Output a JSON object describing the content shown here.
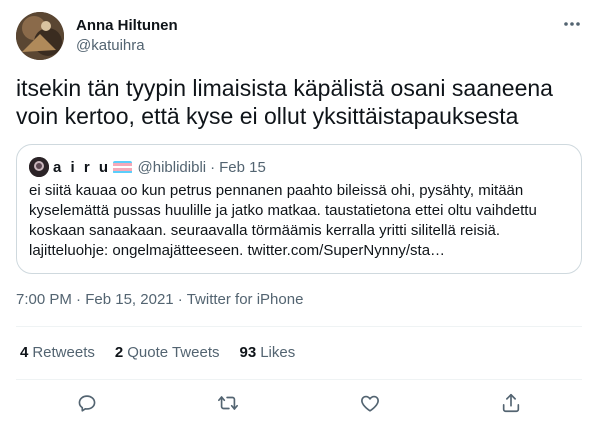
{
  "author": {
    "display_name": "Anna Hiltunen",
    "handle": "@katuihra"
  },
  "tweet": {
    "text": "itsekin tän tyypin limaisista käpälistä osani saaneena voin kertoo, että kyse ei ollut yksittäistapauksesta"
  },
  "quoted_tweet": {
    "display_name": "a i r u",
    "handle": "@hiblidibli",
    "separator": "·",
    "date": "Feb 15",
    "text": "ei siitä kauaa oo kun petrus pennanen paahto bileissä ohi, pysähty, mitään kyselemättä pussas huulille ja jatko matkaa. taustatietona ettei oltu vaihdettu koskaan sanaakaan. seuraavalla törmäämis kerralla yritti silitellä reisiä. lajitteluohje: ongelmajätteeseen. twitter.com/SuperNynny/sta…"
  },
  "meta": {
    "time": "7:00 PM",
    "sep1": "·",
    "date": "Feb 15, 2021",
    "sep2": "·",
    "source": "Twitter for iPhone"
  },
  "stats": {
    "retweets_count": "4",
    "retweets_label": "Retweets",
    "quotes_count": "2",
    "quotes_label": "Quote Tweets",
    "likes_count": "93",
    "likes_label": "Likes"
  },
  "colors": {
    "text_primary": "#0f1419",
    "text_secondary": "#536471",
    "border": "#cfd9de",
    "divider": "#eff3f4",
    "flag_blue": "#5BCEFA",
    "flag_pink": "#F5A9B8",
    "flag_white": "#FFFFFF"
  },
  "icons": {
    "more": "more-dots-icon",
    "reply": "reply-icon",
    "retweet": "retweet-icon",
    "like": "heart-icon",
    "share": "share-icon",
    "flag": "transgender-flag-icon"
  }
}
